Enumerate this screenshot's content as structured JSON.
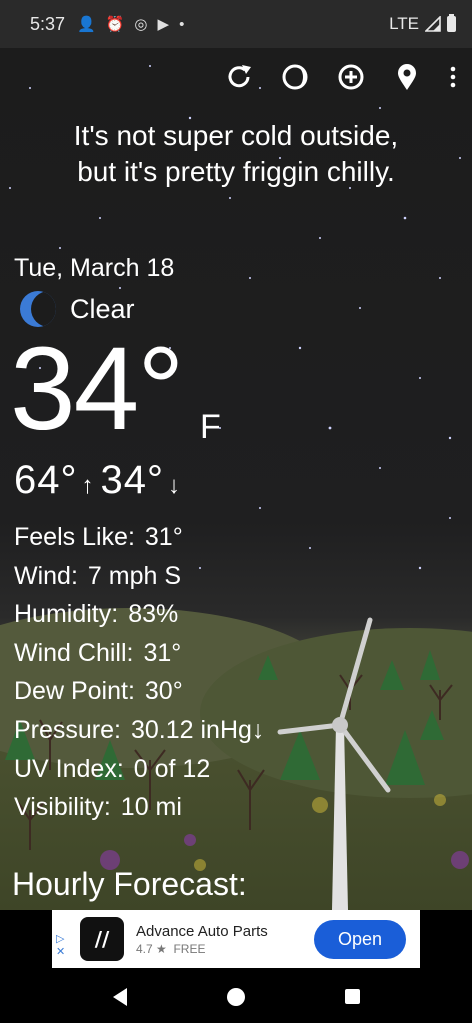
{
  "status_bar": {
    "time": "5:37",
    "network": "LTE"
  },
  "toolbar": {
    "icons": [
      "refresh-icon",
      "theme-icon",
      "add-location-icon",
      "location-pin-icon",
      "more-vert-icon"
    ]
  },
  "headline": {
    "line1": "It's not super cold outside,",
    "line2": "but it's pretty friggin chilly."
  },
  "weather": {
    "date": "Tue, March 18",
    "condition": "Clear",
    "temperature": "34°",
    "unit": "F",
    "high": "64°",
    "low": "34°"
  },
  "details": [
    {
      "label": "Feels Like:",
      "value": "31°"
    },
    {
      "label": "Wind:",
      "value": "7 mph S"
    },
    {
      "label": "Humidity:",
      "value": "83%"
    },
    {
      "label": "Wind Chill:",
      "value": "31°"
    },
    {
      "label": "Dew Point:",
      "value": "30°"
    },
    {
      "label": "Pressure:",
      "value": "30.12 inHg↓"
    },
    {
      "label": "UV Index:",
      "value": "0 of 12"
    },
    {
      "label": "Visibility:",
      "value": "10 mi"
    }
  ],
  "hourly_heading": "Hourly Forecast:",
  "ad": {
    "title": "Advance Auto Parts",
    "rating": "4.7 ★",
    "price": "FREE",
    "cta": "Open"
  },
  "colors": {
    "accent": "#1a5ed8",
    "moon": "#3b7bd6"
  }
}
